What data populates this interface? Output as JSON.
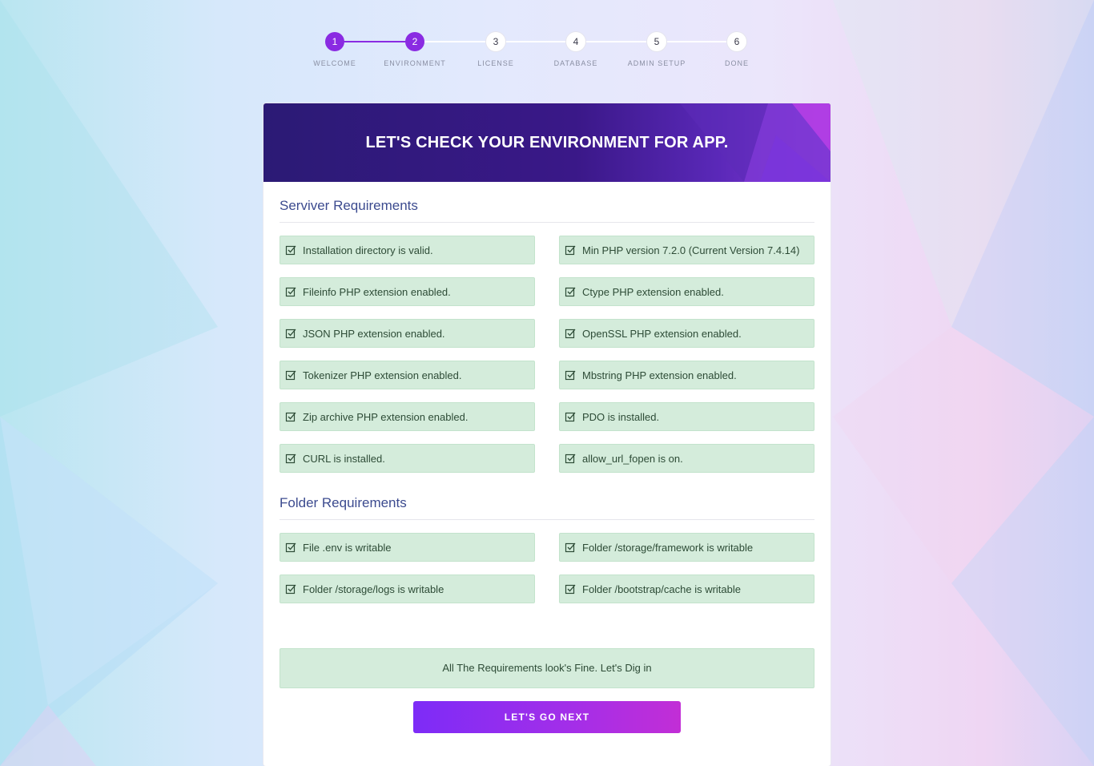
{
  "stepper": {
    "steps": [
      {
        "number": "1",
        "label": "WELCOME",
        "state": "completed"
      },
      {
        "number": "2",
        "label": "ENVIRONMENT",
        "state": "active"
      },
      {
        "number": "3",
        "label": "LICENSE",
        "state": "pending"
      },
      {
        "number": "4",
        "label": "DATABASE",
        "state": "pending"
      },
      {
        "number": "5",
        "label": "ADMIN SETUP",
        "state": "pending"
      },
      {
        "number": "6",
        "label": "DONE",
        "state": "pending"
      }
    ]
  },
  "header": {
    "title": "LET'S CHECK YOUR ENVIRONMENT FOR APP."
  },
  "server_requirements": {
    "title": "Serviver Requirements",
    "items": [
      "Installation directory is valid.",
      "Min PHP version 7.2.0 (Current Version 7.4.14)",
      "Fileinfo PHP extension enabled.",
      "Ctype PHP extension enabled.",
      "JSON PHP extension enabled.",
      "OpenSSL PHP extension enabled.",
      "Tokenizer PHP extension enabled.",
      "Mbstring PHP extension enabled.",
      "Zip archive PHP extension enabled.",
      "PDO is installed.",
      "CURL is installed.",
      "allow_url_fopen is on."
    ]
  },
  "folder_requirements": {
    "title": "Folder Requirements",
    "items": [
      "File .env is writable",
      "Folder /storage/framework is writable",
      "Folder /storage/logs is writable",
      "Folder /bootstrap/cache is writable"
    ]
  },
  "status_message": "All The Requirements look's Fine. Let's Dig in",
  "next_button": {
    "label": "LET'S GO NEXT"
  },
  "colors": {
    "accent": "#8a2be2",
    "success_bg": "#d4ecdb",
    "success_text": "#2d4b36",
    "header_bg": "#2b1a75",
    "section_title": "#3c4b8f"
  }
}
